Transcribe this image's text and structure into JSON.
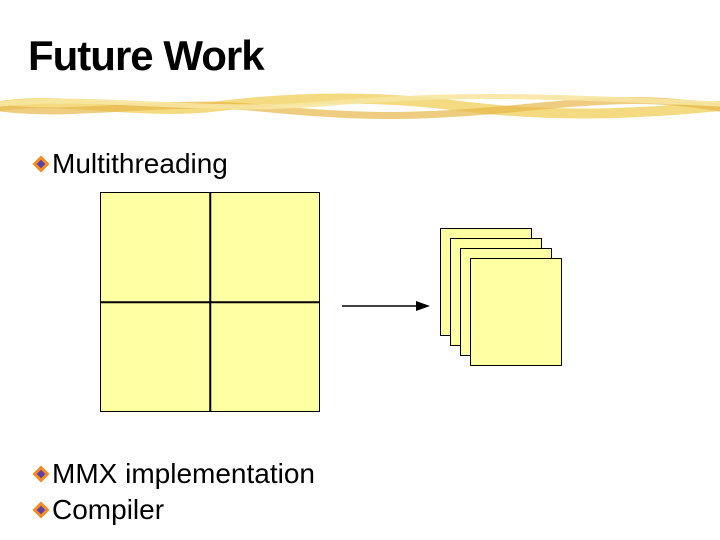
{
  "title": "Future Work",
  "bullets": {
    "b1": "Multithreading",
    "b2": "MMX implementation",
    "b3": "Compiler"
  },
  "colors": {
    "fill": "#ffffa4",
    "underline_a": "#f2d36a",
    "underline_b": "#e7b84a",
    "bullet_orange": "#f58a1f",
    "bullet_purple": "#5a3fb0"
  }
}
